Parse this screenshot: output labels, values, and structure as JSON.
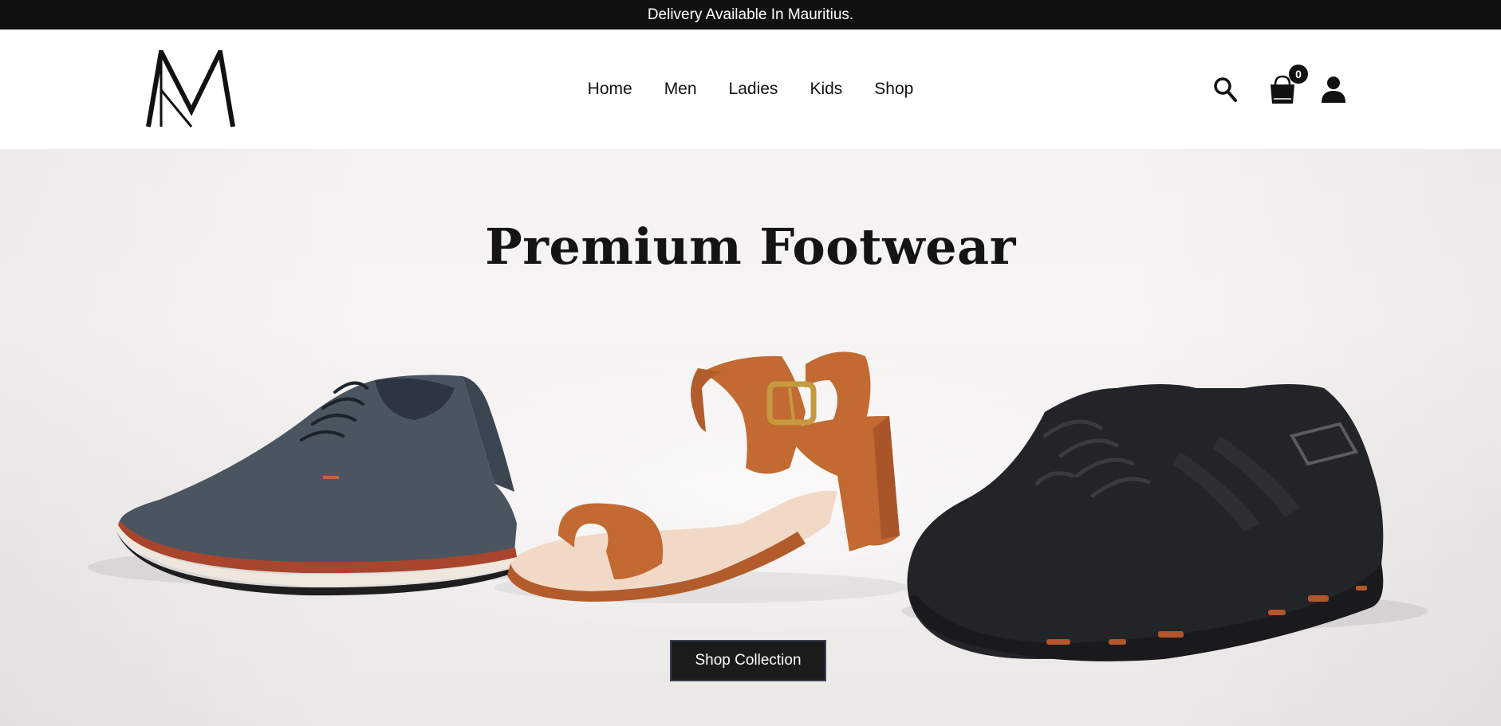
{
  "announcement": {
    "text": "Delivery Available In Mauritius."
  },
  "header": {
    "logo_alt": "M",
    "nav": [
      {
        "label": "Home"
      },
      {
        "label": "Men"
      },
      {
        "label": "Ladies"
      },
      {
        "label": "Kids"
      },
      {
        "label": "Shop"
      }
    ],
    "icons": {
      "search": "search-icon",
      "cart": "shopping-bag-icon",
      "account": "user-icon"
    },
    "cart_count": "0"
  },
  "hero": {
    "title": "Premium Footwear",
    "cta_label": "Shop Collection",
    "products": [
      {
        "name": "gray-derby-shoe",
        "color": "#4a5560"
      },
      {
        "name": "tan-block-heel-sandal",
        "color": "#c26a32"
      },
      {
        "name": "black-running-sneaker",
        "color": "#232427"
      }
    ]
  },
  "colors": {
    "bar": "#111111",
    "accent_orange": "#b5552c",
    "button": "#1b1b1b"
  }
}
